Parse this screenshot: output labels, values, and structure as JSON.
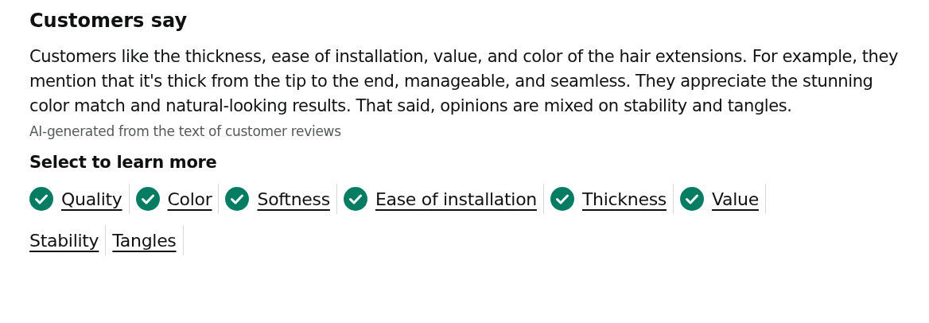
{
  "title": "Customers say",
  "summary": "Customers like the thickness, ease of installation, value, and color of the hair extensions. For example, they mention that it's thick from the tip to the end, manageable, and seamless. They appreciate the stunning color match and natural-looking results. That said, opinions are mixed on stability and tangles.",
  "disclaimer": "AI-generated from the text of customer reviews",
  "aspects_heading": "Select to learn more",
  "aspects": [
    {
      "label": "Quality",
      "positive": true
    },
    {
      "label": "Color",
      "positive": true
    },
    {
      "label": "Softness",
      "positive": true
    },
    {
      "label": "Ease of installation",
      "positive": true
    },
    {
      "label": "Thickness",
      "positive": true
    },
    {
      "label": "Value",
      "positive": true
    },
    {
      "label": "Stability",
      "positive": false
    },
    {
      "label": "Tangles",
      "positive": false
    }
  ]
}
